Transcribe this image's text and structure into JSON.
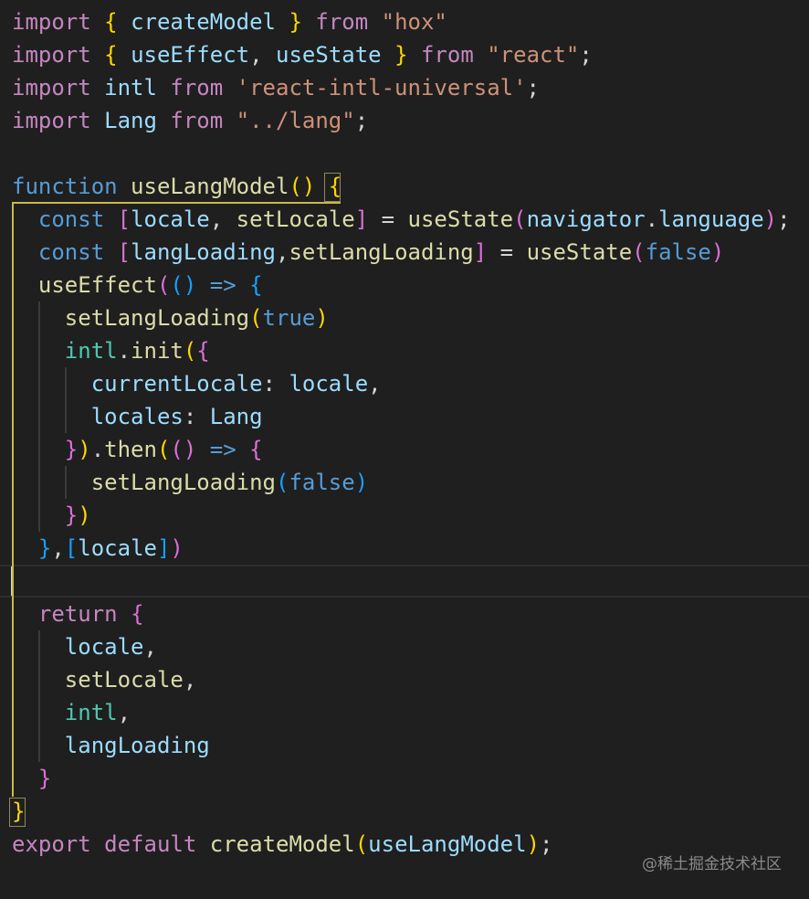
{
  "editor": {
    "language": "javascript",
    "theme_colors": {
      "background": "#1f1f1f",
      "keyword": "#c586c0",
      "storage": "#569cd6",
      "function": "#dcdcaa",
      "variable": "#9cdcfe",
      "string": "#ce9178",
      "bracket_level_1": "#ffd700",
      "bracket_level_2": "#da70d6",
      "bracket_level_3": "#179fff"
    },
    "code": {
      "l1": {
        "t1": "import",
        "t2": "{",
        "t3": "createModel",
        "t4": "}",
        "t5": "from",
        "t6": "\"hox\""
      },
      "l2": {
        "t1": "import",
        "t2": "{",
        "t3": "useEffect",
        "t4": ", ",
        "t5": "useState",
        "t6": "}",
        "t7": "from",
        "t8": "\"react\"",
        "t9": ";"
      },
      "l3": {
        "t1": "import",
        "t2": "intl",
        "t3": "from",
        "t4": "'react-intl-universal'",
        "t5": ";"
      },
      "l4": {
        "t1": "import",
        "t2": "Lang",
        "t3": "from",
        "t4": "\"../lang\"",
        "t5": ";"
      },
      "l6": {
        "t1": "function",
        "t2": "useLangModel",
        "t3": "()",
        "t4": "{"
      },
      "l7": {
        "t1": "const",
        "t2": "[",
        "t3": "locale",
        "t4": ", ",
        "t5": "setLocale",
        "t6": "]",
        "t7": " = ",
        "t8": "useState",
        "t9": "(",
        "t10": "navigator",
        "t11": ".",
        "t12": "language",
        "t13": ")",
        "t14": ";"
      },
      "l8": {
        "t1": "const",
        "t2": "[",
        "t3": "langLoading",
        "t4": ",",
        "t5": "setLangLoading",
        "t6": "]",
        "t7": " = ",
        "t8": "useState",
        "t9": "(",
        "t10": "false",
        "t11": ")"
      },
      "l9": {
        "t1": "useEffect",
        "t2": "(",
        "t3": "()",
        "t4": " => ",
        "t5": "{"
      },
      "l10": {
        "t1": "setLangLoading",
        "t2": "(",
        "t3": "true",
        "t4": ")"
      },
      "l11": {
        "t1": "intl",
        "t2": ".",
        "t3": "init",
        "t4": "(",
        "t5": "{"
      },
      "l12": {
        "t1": "currentLocale",
        "t2": ": ",
        "t3": "locale",
        "t4": ","
      },
      "l13": {
        "t1": "locales",
        "t2": ": ",
        "t3": "Lang"
      },
      "l14": {
        "t1": "}",
        "t2": ")",
        "t3": ".",
        "t4": "then",
        "t5": "(",
        "t6": "()",
        "t7": " => ",
        "t8": "{"
      },
      "l15": {
        "t1": "setLangLoading",
        "t2": "(",
        "t3": "false",
        "t4": ")"
      },
      "l16": {
        "t1": "}",
        "t2": ")"
      },
      "l17": {
        "t1": "}",
        "t2": ",",
        "t3": "[",
        "t4": "locale",
        "t5": "]",
        "t6": ")"
      },
      "l19": {
        "t1": "return",
        "t2": "{"
      },
      "l20": {
        "t1": "locale",
        "t2": ","
      },
      "l21": {
        "t1": "setLocale",
        "t2": ","
      },
      "l22": {
        "t1": "intl",
        "t2": ","
      },
      "l23": {
        "t1": "langLoading"
      },
      "l24": {
        "t1": "}"
      },
      "l25": {
        "t1": "}"
      },
      "l26": {
        "t1": "export",
        "t2": "default",
        "t3": "createModel",
        "t4": "(",
        "t5": "useLangModel",
        "t6": ")",
        "t7": ";"
      }
    }
  },
  "watermark": "@稀土掘金技术社区"
}
